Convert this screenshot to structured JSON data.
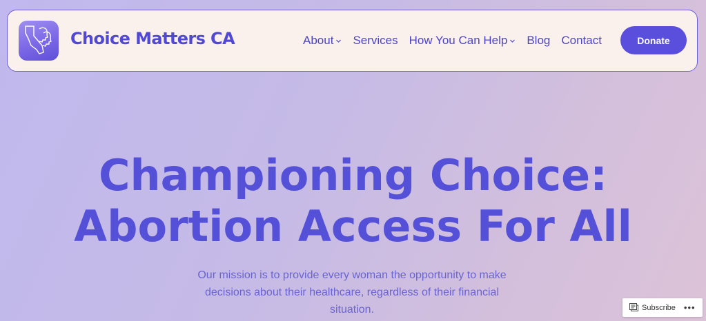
{
  "site": {
    "title": "Choice Matters CA",
    "logo_icon": "california-silhouettes-logo",
    "brand_color": "#5148d4"
  },
  "nav": {
    "items": [
      {
        "label": "About",
        "has_dropdown": true
      },
      {
        "label": "Services",
        "has_dropdown": false
      },
      {
        "label": "How You Can Help",
        "has_dropdown": true
      },
      {
        "label": "Blog",
        "has_dropdown": false
      },
      {
        "label": "Contact",
        "has_dropdown": false
      }
    ],
    "donate_label": "Donate",
    "donate_color": "#5a4fdc"
  },
  "hero": {
    "title_line1": "Championing Choice:",
    "title_line2": "Abortion Access For All",
    "subtitle": "Our mission is to provide every woman the opportunity to make decisions about their healthcare, regardless of their financial situation."
  },
  "subscribe": {
    "label": "Subscribe",
    "icon": "reader-icon",
    "more_label": "•••"
  }
}
